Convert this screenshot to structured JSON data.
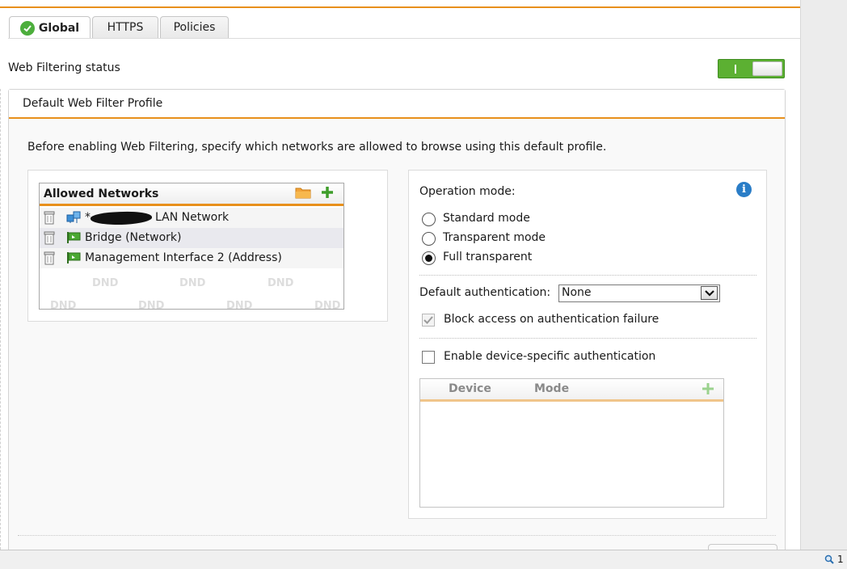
{
  "tabs": [
    {
      "label": "Global",
      "icon": "check-circle-icon",
      "active": true
    },
    {
      "label": "HTTPS",
      "active": false
    },
    {
      "label": "Policies",
      "active": false
    }
  ],
  "status": {
    "label": "Web Filtering status",
    "enabled": true,
    "toggle_on_text": "I"
  },
  "profile": {
    "title": "Default Web Filter Profile",
    "intro": "Before enabling Web Filtering, specify which networks are allowed to browse using this default profile."
  },
  "networks": {
    "title": "Allowed Networks",
    "items": [
      {
        "label": "*",
        "label_suffix": "LAN Network",
        "icon": "network-icon"
      },
      {
        "label": "Bridge (Network)",
        "icon": "green-flag-icon"
      },
      {
        "label": "Management Interface 2 (Address)",
        "icon": "green-flag-icon"
      }
    ],
    "dnd_label": "DND"
  },
  "operation": {
    "label": "Operation mode:",
    "modes": [
      {
        "label": "Standard mode",
        "checked": false
      },
      {
        "label": "Transparent mode",
        "checked": false
      },
      {
        "label": "Full transparent",
        "checked": true
      }
    ]
  },
  "authentication": {
    "label": "Default authentication:",
    "value": "None",
    "block_label": "Block access on authentication failure",
    "block_checked": true,
    "device_label": "Enable device-specific authentication",
    "device_checked": false
  },
  "device_table": {
    "columns": [
      "Device",
      "Mode"
    ],
    "rows": []
  },
  "statusbar": {
    "zoom_text": "1"
  },
  "colors": {
    "accent": "#e8901c",
    "toggle_green": "#5cb032",
    "info_blue": "#2a7dc7",
    "plus_green": "#3e9d2a"
  }
}
